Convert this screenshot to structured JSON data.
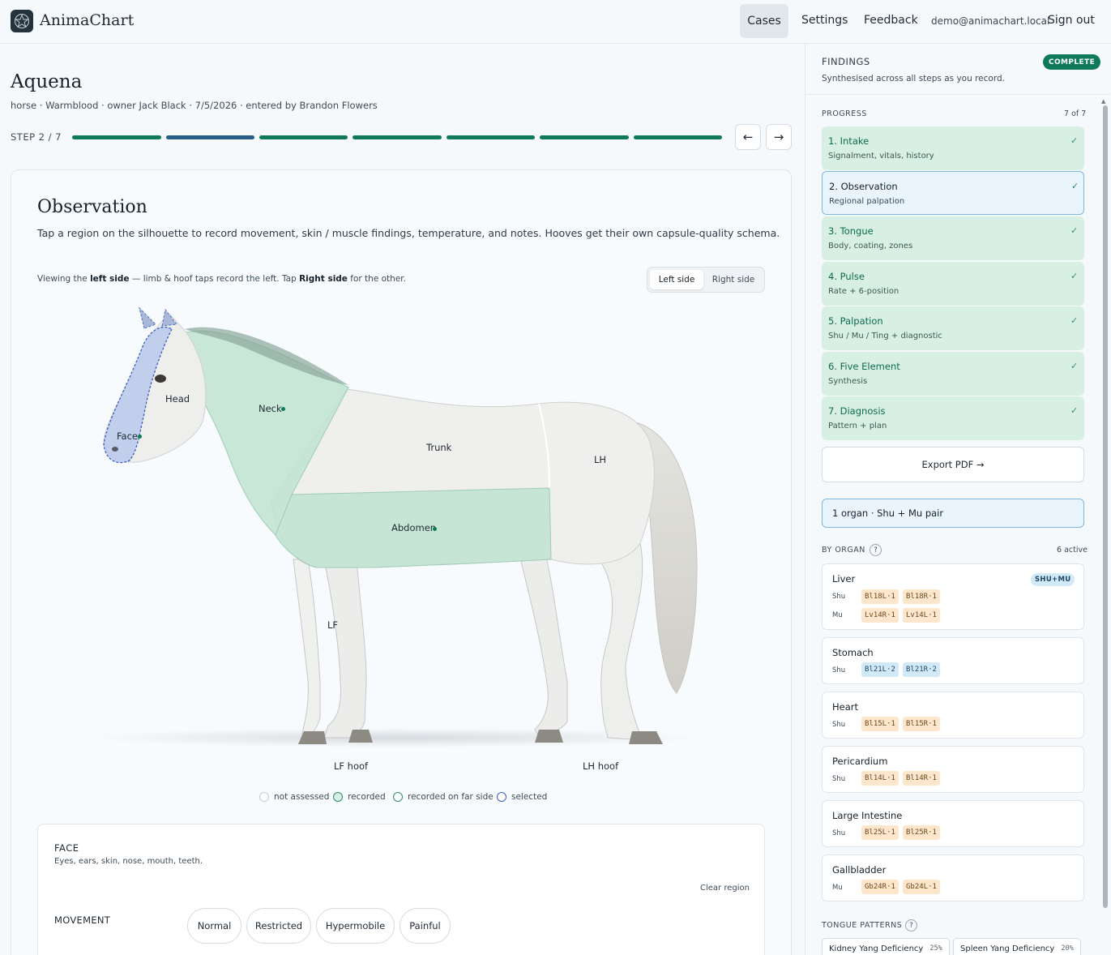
{
  "app": {
    "name": "AnimaChart"
  },
  "nav": {
    "cases": "Cases",
    "settings": "Settings",
    "feedback": "Feedback",
    "email": "demo@animachart.local",
    "signout": "Sign out"
  },
  "case": {
    "name": "Aquena",
    "meta": "horse · Warmblood · owner Jack Black · 7/5/2026 · entered by Brandon Flowers",
    "step_label": "STEP 2 / 7",
    "prev_icon": "←",
    "next_icon": "→"
  },
  "observation": {
    "title": "Observation",
    "description": "Tap a region on the silhouette to record movement, skin / muscle findings, temperature, and notes. Hooves get their own capsule-quality schema.",
    "view_prefix": "Viewing the ",
    "view_side": "left side",
    "view_mid": " — limb & hoof taps record the left. Tap ",
    "view_other": "Right side",
    "view_suffix": " for the other.",
    "toggle_left": "Left side",
    "toggle_right": "Right side",
    "regions": {
      "head": "Head",
      "face": "Face",
      "neck": "Neck",
      "trunk": "Trunk",
      "abdomen": "Abdomen",
      "lh": "LH",
      "lf": "LF",
      "lf_hoof": "LF hoof",
      "lh_hoof": "LH hoof"
    },
    "legend": {
      "not_assessed": "not assessed",
      "recorded": "recorded",
      "recorded_far": "recorded on far side",
      "selected": "selected"
    }
  },
  "region_panel": {
    "title": "FACE",
    "subtitle": "Eyes, ears, skin, nose, mouth, teeth.",
    "clear": "Clear region",
    "movement_label": "MOVEMENT",
    "movement_options": [
      "Normal",
      "Restricted",
      "Hypermobile",
      "Painful"
    ]
  },
  "findings": {
    "title": "FINDINGS",
    "subtitle": "Synthesised across all steps as you record.",
    "badge": "COMPLETE",
    "progress_label": "PROGRESS",
    "progress_count": "7 of 7",
    "steps": [
      {
        "title": "1. Intake",
        "sub": "Signalment, vitals, history"
      },
      {
        "title": "2. Observation",
        "sub": "Regional palpation"
      },
      {
        "title": "3. Tongue",
        "sub": "Body, coating, zones"
      },
      {
        "title": "4. Pulse",
        "sub": "Rate + 6-position"
      },
      {
        "title": "5. Palpation",
        "sub": "Shu / Mu / Ting + diagnostic"
      },
      {
        "title": "6. Five Element",
        "sub": "Synthesis"
      },
      {
        "title": "7. Diagnosis",
        "sub": "Pattern + plan"
      }
    ],
    "check": "✓",
    "export": "Export PDF →",
    "pair_summary": "1 organ · Shu + Mu pair",
    "by_organ_label": "BY ORGAN",
    "help": "?",
    "active_count": "6 active",
    "shumu_badge": "SHU+MU",
    "organs": [
      {
        "name": "Liver",
        "rows": [
          {
            "label": "Shu",
            "points": [
              "Bl18L·1",
              "Bl18R·1"
            ]
          },
          {
            "label": "Mu",
            "points": [
              "Lv14R·1",
              "Lv14L·1"
            ]
          }
        ]
      },
      {
        "name": "Stomach",
        "rows": [
          {
            "label": "Shu",
            "points": [
              "Bl21L·2",
              "Bl21R·2"
            ]
          }
        ]
      },
      {
        "name": "Heart",
        "rows": [
          {
            "label": "Shu",
            "points": [
              "Bl15L·1",
              "Bl15R·1"
            ]
          }
        ]
      },
      {
        "name": "Pericardium",
        "rows": [
          {
            "label": "Shu",
            "points": [
              "Bl14L·1",
              "Bl14R·1"
            ]
          }
        ]
      },
      {
        "name": "Large Intestine",
        "rows": [
          {
            "label": "Shu",
            "points": [
              "Bl25L·1",
              "Bl25R·1"
            ]
          }
        ]
      },
      {
        "name": "Gallbladder",
        "rows": [
          {
            "label": "Mu",
            "points": [
              "Gb24R·1",
              "Gb24L·1"
            ]
          }
        ]
      }
    ],
    "tongue_label": "TONGUE PATTERNS",
    "tongue_patterns": [
      {
        "name": "Kidney Yang Deficiency",
        "pct": "25%"
      },
      {
        "name": "Spleen Yang Deficiency",
        "pct": "20%"
      }
    ]
  },
  "colors": {
    "accent_green": "#0e7a5a",
    "accent_blue": "#2a5d87",
    "recorded_fill": "#bfe3d0",
    "selected_fill": "#b9c8ec"
  }
}
